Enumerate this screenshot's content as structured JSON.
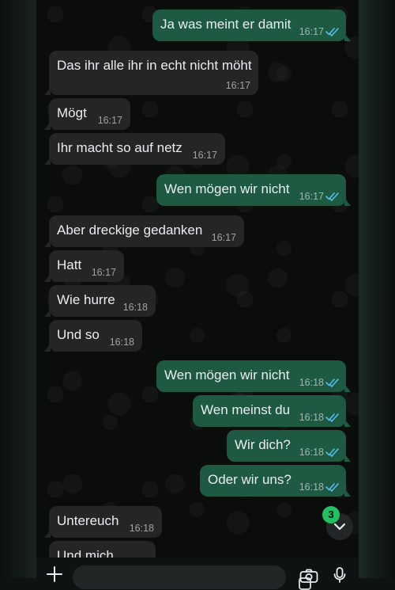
{
  "messages": [
    {
      "dir": "out",
      "text": "Ja was meint er damit",
      "time": "16:17",
      "read": true
    },
    {
      "dir": "in",
      "text": "Das ihr alle ihr in echt nicht möht",
      "time": "16:17"
    },
    {
      "dir": "in",
      "text": "Mögt",
      "time": "16:17"
    },
    {
      "dir": "in",
      "text": "Ihr macht so auf netz",
      "time": "16:17"
    },
    {
      "dir": "out",
      "text": "Wen mögen wir nicht",
      "time": "16:17",
      "read": true
    },
    {
      "dir": "in",
      "text": "Aber dreckige gedanken",
      "time": "16:17"
    },
    {
      "dir": "in",
      "text": "Hatt",
      "time": "16:17"
    },
    {
      "dir": "in",
      "text": "Wie hurre",
      "time": "16:18"
    },
    {
      "dir": "in",
      "text": "Und so",
      "time": "16:18"
    },
    {
      "dir": "out",
      "text": "Wen mögen wir nicht",
      "time": "16:18",
      "read": true
    },
    {
      "dir": "out",
      "text": "Wen meinst du",
      "time": "16:18",
      "read": true
    },
    {
      "dir": "out",
      "text": "Wir dich?",
      "time": "16:18",
      "read": true
    },
    {
      "dir": "out",
      "text": "Oder wir uns?",
      "time": "16:18",
      "read": true
    },
    {
      "dir": "in",
      "text": "Untereuch",
      "time": "16:18"
    },
    {
      "dir": "in",
      "text": "Und mich",
      "time": ""
    }
  ],
  "scroll_down": {
    "unread_count": "3",
    "icon": "chevron-down-icon"
  },
  "input_bar": {
    "plus_icon": "plus-icon",
    "sticker_icon": "sticker-icon",
    "camera_icon": "camera-icon",
    "mic_icon": "microphone-icon"
  },
  "colors": {
    "incoming_bubble": "#242626",
    "outgoing_bubble": "#1e5a42",
    "read_ticks": "#53bdeb",
    "unread_badge": "#21c063"
  }
}
